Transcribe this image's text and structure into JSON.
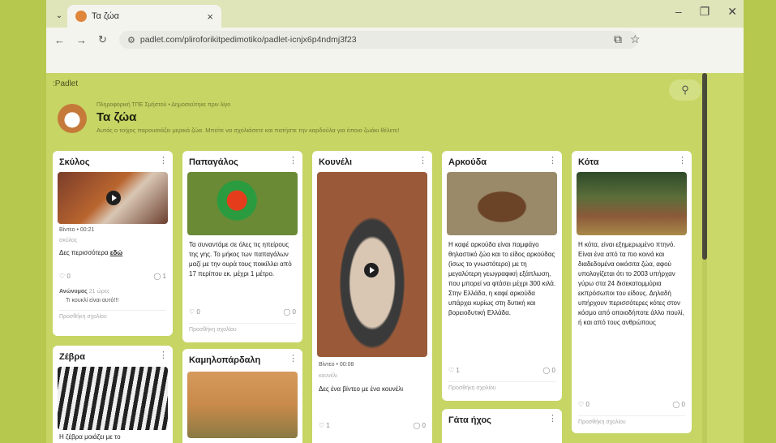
{
  "browser": {
    "tab_title": "Τα ζώα",
    "url": "padlet.com/pliroforikitpedimotiko/padlet-icnjx6p4ndmj3f23"
  },
  "padlet": {
    "logo": ":Padlet",
    "author": "Πληροφορική ΤΠΕ Σμήστού • Δημοσιεύτηκε πριν λίγο",
    "title": "Τα ζώα",
    "description": "Αυτός ο τοίχος παρουσιάζει μερικά ζώα. Μπείτε να σχολιάσετε και πατήστε την καρδούλα για όποιο ζωάκι θέλετε!"
  },
  "posts": {
    "dog": {
      "title": "Σκύλος",
      "video_meta": "Βίντεο • 00:21",
      "caption": "σκύλος",
      "text": "Δες περισσότερα",
      "link": "εδώ",
      "likes": "0",
      "comments": "1",
      "commenter": "Ανώνυμος",
      "comment": "Τι κουκλί είναι αυτό!!!",
      "comment_time": "21 ώρες",
      "add_comment": "Προσθήκη σχολίου"
    },
    "zebra": {
      "title": "Ζέβρα",
      "text": "Η ζέβρα μοιάζει με το"
    },
    "parrot": {
      "title": "Παπαγάλος",
      "text": "Τα συναντάμε σε όλες τις ηπείρους της γης. Το μήκος των παπαγάλων μαζί με την ουρά τους ποικίλλει από 17 περίπου εκ. μέχρι 1 μέτρο.",
      "likes": "0",
      "comments": "0",
      "add_comment": "Προσθήκη σχολίου"
    },
    "giraffe": {
      "title": "Καμηλοπάρδαλη"
    },
    "rabbit": {
      "title": "Κουνέλι",
      "video_meta": "Βίντεο • 00:08",
      "caption": "κουνέλι",
      "text": "Δες ένα βίντεο με ένα κουνέλι",
      "likes": "1",
      "comments": "0"
    },
    "bear": {
      "title": "Αρκούδα",
      "text": "Η καφέ αρκούδα είναι παμφάγο θηλαστικό ζώο και το είδος αρκούδας (ίσως το γνωστότερο) με τη μεγαλύτερη γεωγραφική εξάπλωση, που μπορεί να φτάσει μέχρι 300 κιλά. Στην Ελλάδα, η καφέ αρκούδα υπάρχει κυρίως στη δυτική και βορειοδυτική Ελλάδα.",
      "likes": "1",
      "comments": "0",
      "add_comment": "Προσθήκη σχολίου"
    },
    "cat": {
      "title": "Γάτα ήχος"
    },
    "hen": {
      "title": "Κότα",
      "text": "Η κότα, είναι εξημερωμένο πτηνό. Είναι ένα από τα πιο κοινά και διαδεδομένα οικόσιτα ζώα, αφού υπολογίζεται ότι το 2003 υπήρχαν γύρω στα 24 δισεκατομμύρια εκπρόσωποι του είδους. Δηλαδή υπήρχουν περισσότερες κότες στον κόσμο από οποιοδήποτε άλλο πουλί, ή και από τους ανθρώπους",
      "likes": "0",
      "comments": "0",
      "add_comment": "Προσθήκη σχολίου"
    }
  },
  "icons": {
    "kebab": "⋮",
    "heart": "♡",
    "comment": "◯",
    "search": "⚲"
  },
  "colors": {
    "background": "#c6d564",
    "accent": "#b7c84f"
  }
}
